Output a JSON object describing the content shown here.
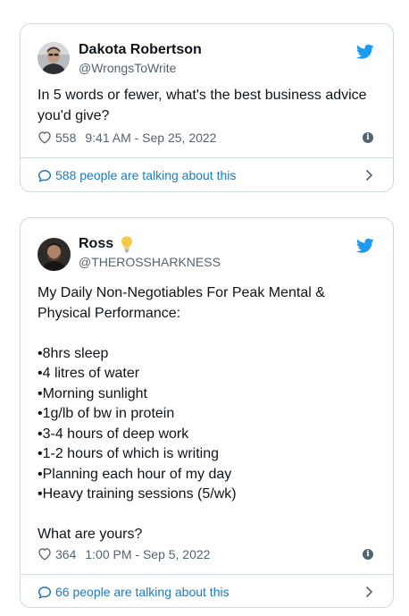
{
  "tweets": [
    {
      "author": {
        "name": "Dakota Robertson",
        "handle": "@WrongsToWrite",
        "avatar_icon": "avatar-photo"
      },
      "text_lines": [
        "In 5 words or fewer, what's the best business advice",
        "you'd give?"
      ],
      "likes": "558",
      "timestamp": "9:41 AM - Sep 25, 2022",
      "talking": "588 people are talking about this"
    },
    {
      "author": {
        "name": "Ross",
        "handle": "@THEROSSHARKNESS",
        "avatar_icon": "avatar-photo",
        "emoji": "lightbulb-icon"
      },
      "text_lines": [
        "My Daily Non-Negotiables For Peak Mental &",
        "Physical Performance:",
        "",
        "•8hrs sleep",
        "•4 litres of water",
        "•Morning sunlight",
        "•1g/lb of bw in protein",
        "•3-4 hours of deep work",
        "•1-2 hours of which is writing",
        "•Planning each hour of my day",
        "•Heavy training sessions (5/wk)",
        "",
        "What are yours?"
      ],
      "likes": "364",
      "timestamp": "1:00 PM - Sep 5, 2022",
      "talking": "66 people are talking about this"
    }
  ],
  "colors": {
    "twitter_blue": "#1d9bf0",
    "link_blue": "#1d7ac0",
    "muted_gray": "#536471",
    "border": "#cfd9de"
  }
}
